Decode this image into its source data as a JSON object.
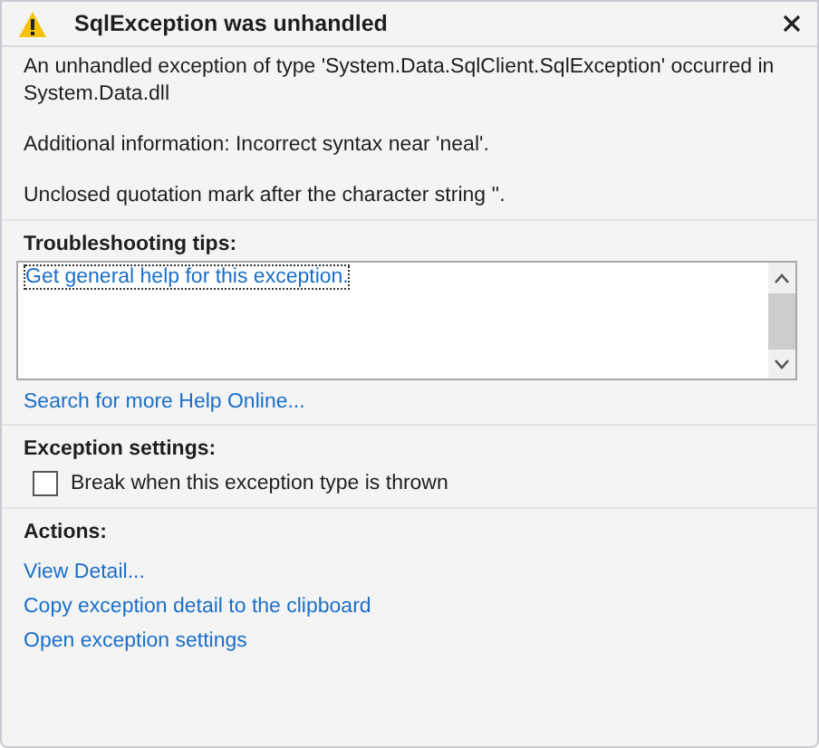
{
  "window": {
    "title": "SqlException was unhandled"
  },
  "message": [
    "An unhandled exception of type 'System.Data.SqlClient.SqlException' occurred in System.Data.dll",
    "Additional information: Incorrect syntax near 'neal'.",
    "Unclosed quotation mark after the character string ''."
  ],
  "troubleshooting": {
    "heading": "Troubleshooting tips:",
    "tips": [
      {
        "label": "Get general help for this exception.",
        "selected": true
      }
    ],
    "search_link": "Search for more Help Online..."
  },
  "exception_settings": {
    "heading": "Exception settings:",
    "options": [
      {
        "label": "Break when this exception type is thrown",
        "checked": false
      }
    ]
  },
  "actions": {
    "heading": "Actions:",
    "links": [
      "View Detail...",
      "Copy exception detail to the clipboard",
      "Open exception settings"
    ]
  }
}
